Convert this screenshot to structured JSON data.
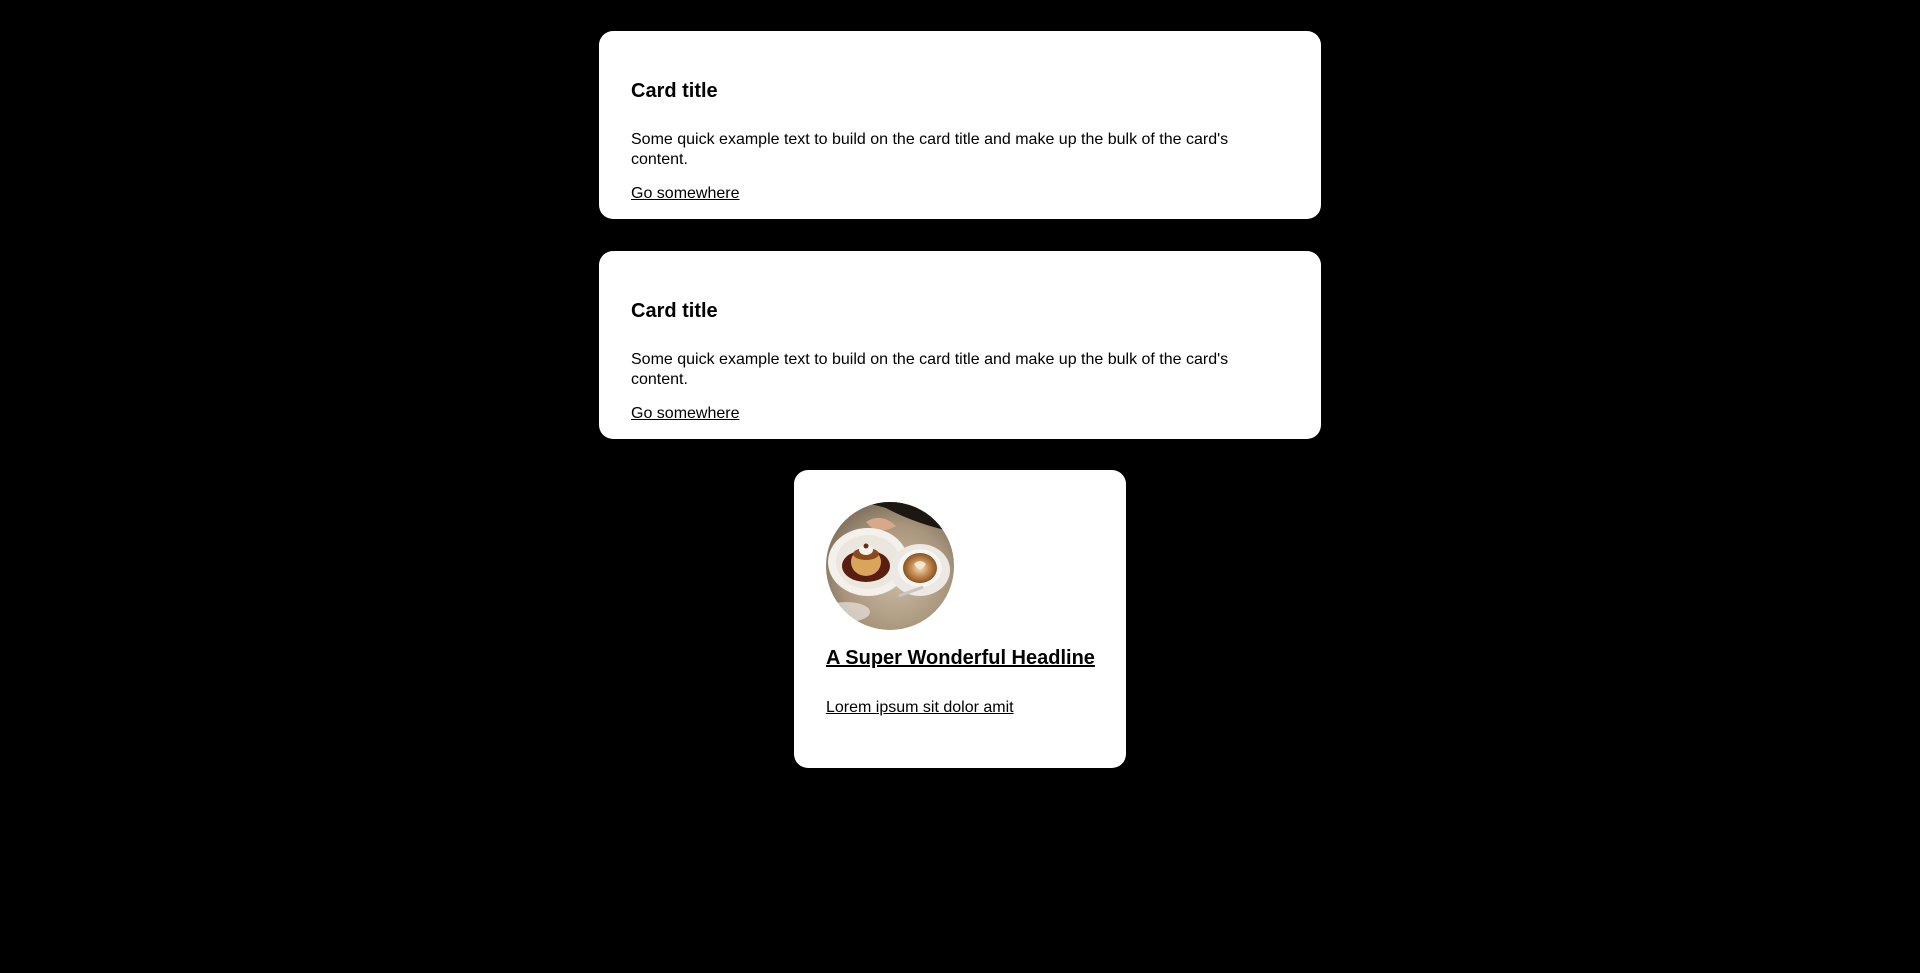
{
  "cards": [
    {
      "title": "Card title",
      "text": "Some quick example text to build on the card title and make up the bulk of the card's content.",
      "link": "Go somewhere"
    },
    {
      "title": "Card title",
      "text": "Some quick example text to build on the card title and make up the bulk of the card's content.",
      "link": "Go somewhere"
    }
  ],
  "profile_card": {
    "image": "coffee-and-dessert-photo",
    "headline": "A Super Wonderful Headline",
    "subtext": "Lorem ipsum sit dolor amit"
  },
  "colors": {
    "background": "#000000",
    "card": "#ffffff",
    "text": "#000000"
  }
}
